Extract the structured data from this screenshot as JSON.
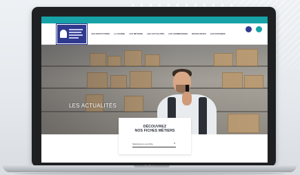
{
  "window": {
    "brand": "MacBook"
  },
  "nav": {
    "menu": [
      "LES INSTITUTIONS",
      "LA FILIÈRE",
      "LES MÉTIERS",
      "LES ACTUALITÉS",
      "LES COMMISSIONS",
      "RESSOURCES",
      "LES DOSSIERS"
    ],
    "icons": [
      {
        "name": "account-icon",
        "color": "#2f3a8f"
      },
      {
        "name": "region-icon",
        "color": "#16a2a6"
      }
    ]
  },
  "hero": {
    "title": "LES ACTUALITÉS"
  },
  "card": {
    "title_line1": "DÉCOUVREZ",
    "title_line2": "NOS FICHES MÉTIERS",
    "select_value": "Sélectionner une fiche"
  },
  "colors": {
    "accent": "#16a2a6",
    "brand": "#2f3a8f"
  }
}
